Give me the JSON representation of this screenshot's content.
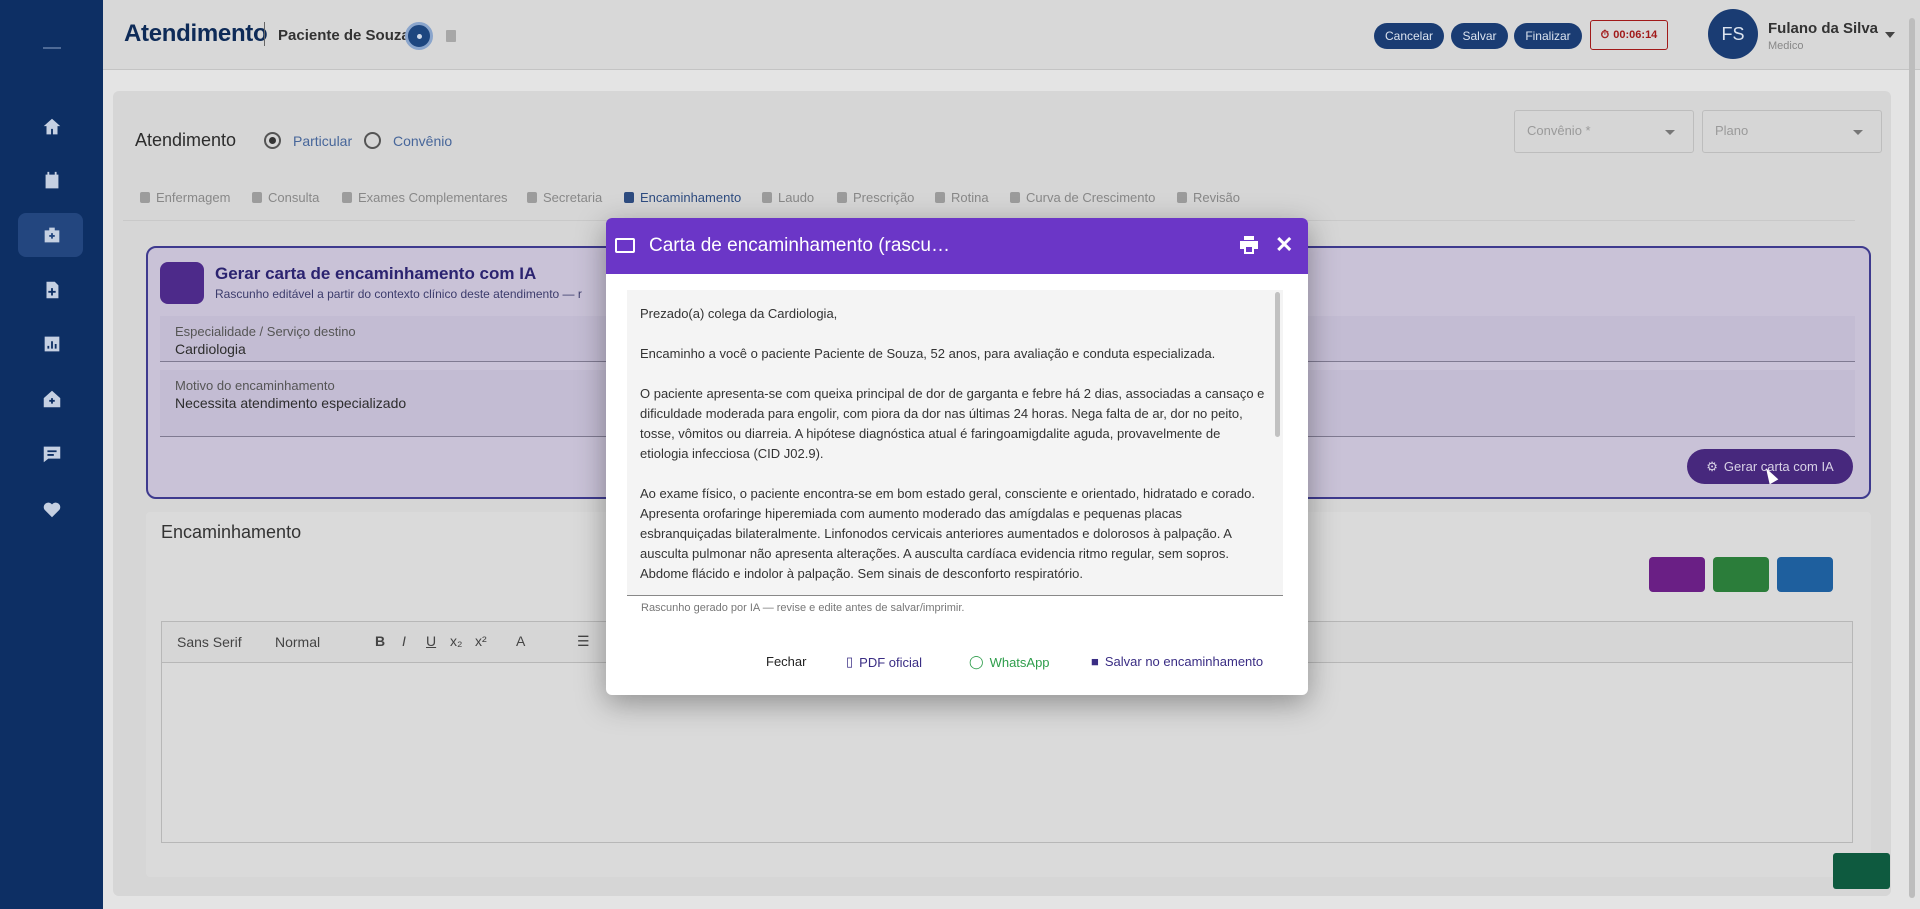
{
  "sidebar": {
    "items": [
      "home-icon",
      "calendar-icon",
      "medical-bag-icon",
      "patient-file-icon",
      "chart-icon",
      "house-medical-icon",
      "message-icon",
      "heart-pulse-icon"
    ]
  },
  "header": {
    "title": "Atendimento",
    "patient": "Paciente de Souza",
    "buttons": {
      "cancel": "Cancelar",
      "save": "Salvar",
      "finish": "Finalizar"
    },
    "timer": "00:06:14",
    "user": {
      "initials": "FS",
      "name": "Fulano da Silva",
      "role": "Medico"
    }
  },
  "main": {
    "title": "Atendimento",
    "radio_particular": "Particular",
    "radio_convenio": "Convênio",
    "select_convenio": "Convênio *",
    "select_plano": "Plano",
    "tabs": [
      "Enfermagem",
      "Consulta",
      "Exames Complementares",
      "Secretaria",
      "Encaminhamento",
      "Laudo",
      "Prescrição",
      "Rotina",
      "Curva de Crescimento",
      "Revisão"
    ]
  },
  "ai_card": {
    "title": "Gerar carta de encaminhamento com IA",
    "subtitle": "Rascunho editável a partir do contexto clínico deste atendimento — r",
    "specialty_label": "Especialidade / Serviço destino",
    "specialty_value": "Cardiologia",
    "reason_label": "Motivo do encaminhamento",
    "reason_value": "Necessita atendimento especializado",
    "generate_button": "Gerar carta com IA"
  },
  "encaminhamento": {
    "title": "Encaminhamento",
    "font": "Sans Serif",
    "size": "Normal"
  },
  "modal": {
    "title": "Carta de encaminhamento (rascu…",
    "paragraphs": [
      "Prezado(a) colega da Cardiologia,",
      "Encaminho a você o paciente Paciente de Souza, 52 anos, para avaliação e conduta especializada.",
      "O paciente apresenta-se com queixa principal de dor de garganta e febre há 2 dias, associadas a cansaço e dificuldade moderada para engolir, com piora da dor nas últimas 24 horas. Nega falta de ar, dor no peito, tosse, vômitos ou diarreia. A hipótese diagnóstica atual é faringoamigdalite aguda, provavelmente de etiologia infecciosa (CID J02.9).",
      "Ao exame físico, o paciente encontra-se em bom estado geral, consciente e orientado, hidratado e corado. Apresenta orofaringe hiperemiada com aumento moderado das amígdalas e pequenas placas esbranquiçadas bilateralmente. Linfonodos cervicais anteriores aumentados e dolorosos à palpação. A ausculta pulmonar não apresenta alterações. A ausculta cardíaca evidencia ritmo regular, sem sopros. Abdome flácido e indolor à palpação. Sem sinais de desconforto respiratório."
    ],
    "note": "Rascunho gerado por IA — revise e edite antes de salvar/imprimir.",
    "footer": {
      "close": "Fechar",
      "pdf": "PDF oficial",
      "whatsapp": "WhatsApp",
      "save": "Salvar no encaminhamento"
    }
  },
  "colors": {
    "navy": "#0d2f64",
    "purple": "#6b36c7",
    "whatsapp": "#2e9d4b"
  }
}
